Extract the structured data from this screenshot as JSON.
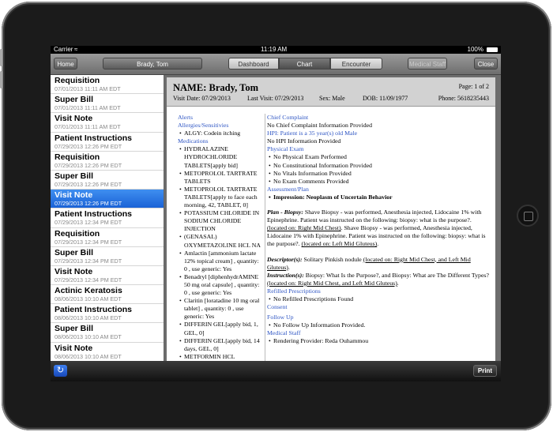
{
  "status_bar": {
    "carrier": "Carrier",
    "time": "11:19 AM",
    "right": "100%"
  },
  "nav": {
    "home": "Home",
    "patient": "Brady, Tom",
    "tabs": [
      "Dashboard",
      "Chart",
      "Encounter"
    ],
    "active_tab": "Chart",
    "medical_staff": "Medical Staff",
    "close": "Close"
  },
  "sidebar": {
    "items": [
      {
        "title": "Requisition",
        "date": "07/01/2013 11:11 AM EDT"
      },
      {
        "title": "Super Bill",
        "date": "07/01/2013 11:11 AM EDT"
      },
      {
        "title": "Visit Note",
        "date": "07/01/2013 11:11 AM EDT"
      },
      {
        "title": "Patient Instructions",
        "date": "07/29/2013 12:26 PM EDT"
      },
      {
        "title": "Requisition",
        "date": "07/29/2013 12:26 PM EDT"
      },
      {
        "title": "Super Bill",
        "date": "07/29/2013 12:26 PM EDT"
      },
      {
        "title": "Visit Note",
        "date": "07/29/2013 12:26 PM EDT",
        "selected": true
      },
      {
        "title": "Patient Instructions",
        "date": "07/29/2013 12:34 PM EDT"
      },
      {
        "title": "Requisition",
        "date": "07/29/2013 12:34 PM EDT"
      },
      {
        "title": "Super Bill",
        "date": "07/29/2013 12:34 PM EDT"
      },
      {
        "title": "Visit Note",
        "date": "07/29/2013 12:34 PM EDT"
      },
      {
        "title": "Actinic Keratosis",
        "date": "08/06/2013 10:10 AM EDT"
      },
      {
        "title": "Patient Instructions",
        "date": "08/06/2013 10:10 AM EDT"
      },
      {
        "title": "Super Bill",
        "date": "08/06/2013 10:10 AM EDT"
      },
      {
        "title": "Visit Note",
        "date": "08/06/2013 10:10 AM EDT"
      }
    ]
  },
  "doc": {
    "name": "NAME: Brady, Tom",
    "page": "Page: 1 of 2",
    "visit_date": "Visit Date: 07/29/2013",
    "last_visit": "Last Visit: 07/29/2013",
    "sex": "Sex: Male",
    "dob": "DOB: 11/09/1977",
    "phone": "Phone: 5618235443",
    "left": {
      "alerts": "Alerts",
      "allergies_heading": "Allergies/Sensitivies",
      "allergies": [
        "ALGY: Codein itching"
      ],
      "medications_heading": "Medications",
      "medications": [
        "HYDRALAZINE HYDROCHLORIDE TABLETS[apply bid]",
        "METOPROLOL TARTRATE TABLETS",
        "METOPROLOL TARTRATE TABLETS[apply to face each morning, 42, TABLET, 0]",
        "POTASSIUM CHLORIDE IN SODIUM CHLORIDE INJECTION",
        "(GENASAL) OXYMETAZOLINE HCL NA",
        "Amlactin [ammonium lactate 12% topical cream] , quantity: 0 , use generic: Yes",
        "Benadryl [diphenhydrAMINE 50 mg oral capsule] , quantity: 0 , use generic: Yes",
        "Claritin [loratadine 10 mg oral tablet] , quantity: 0 , use generic: Yes",
        "DIFFERIN GEL[apply bid, 1, GEL, 0]",
        "DIFFERIN GEL[apply bid, 14 days, GEL, 0]",
        "METFORMIN HCL"
      ]
    },
    "right": {
      "chief_complaint_heading": "Chief Complaint",
      "chief_complaint": "No Chief Complaint Information Provided",
      "hpi_heading": "HPI: Patient is a 35 year(s) old Male",
      "hpi": "No HPI Information Provided",
      "physical_exam_heading": "Physical Exam",
      "physical_exam": [
        "No Physical Exam Performed",
        "No Constitutional Information Provided",
        "No Vitals Information Provided",
        "No Exam Comments Provided"
      ],
      "assessment_heading": "Assessment/Plan",
      "impression": "Impression: Neoplasm of Uncertain Behavior",
      "plan_label": "Plan - Biopsy:",
      "plan_text_1": " Shave Biopsy - was performed, Anesthesia injected, Lidocaine 1% with Epinephrine. Patient was instructed on the following: biopsy: what is the purpose?. ",
      "plan_loc_1": "(located on: Right Mid Chest)",
      "plan_text_2": ". Shave Biopsy - was performed, Anesthesia injected, Lidocaine 1% with Epinephrine. Patient was instructed on the following: biopsy: what is the purpose?. ",
      "plan_loc_2": "(located on: Left Mid Gluteus)",
      "plan_end": ".",
      "descriptor_label": "Descriptor(s):",
      "descriptor_text": " Solitary Pinkish nodule ",
      "descriptor_loc": "(located on: Right Mid Chest, and Left Mid Gluteus)",
      "descriptor_end": ".",
      "instruction_label": "Instruction(s):",
      "instruction_text": " Biopsy: What Is the Purpose?, and Biopsy: What are The Different Types? ",
      "instruction_loc": "(located on: Right Mid Chest, and Left Mid Gluteus)",
      "instruction_end": ".",
      "refilled_heading": "Refilled Prescriptions",
      "refilled": "No Refilled Prescriptions Found",
      "consent_heading": "Consent",
      "followup_heading": "Follow Up",
      "followup": "No Follow Up Information Provided.",
      "medical_staff_heading": "Medical Staff",
      "rendering_provider": "Rendering Provider: Reda Ouhammou"
    }
  },
  "bottom": {
    "refresh_icon": "refresh-icon",
    "print": "Print"
  }
}
